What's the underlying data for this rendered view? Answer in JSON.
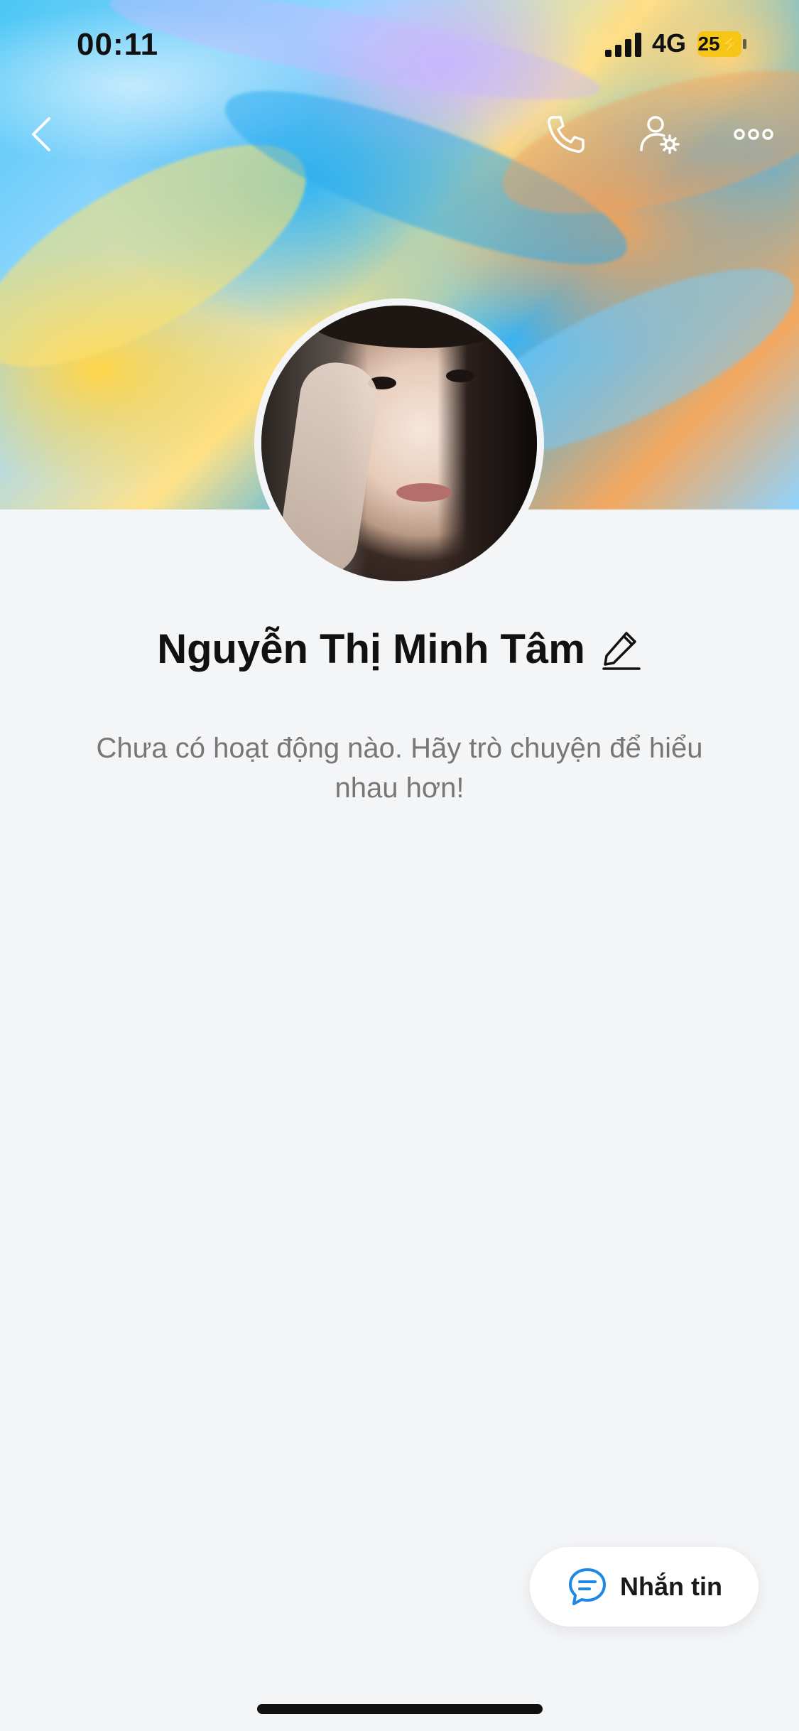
{
  "status_bar": {
    "time": "00:11",
    "network": "4G",
    "battery": "25"
  },
  "header": {
    "back_icon": "chevron-left-icon",
    "call_icon": "phone-icon",
    "settings_icon": "user-settings-icon",
    "more_icon": "more-horizontal-icon"
  },
  "profile": {
    "name": "Nguyễn Thị Minh Tâm",
    "edit_icon": "pencil-icon",
    "empty_message": "Chưa có hoạt động nào. Hãy trò chuyện để hiểu nhau hơn!"
  },
  "action": {
    "message_label": "Nhắn tin",
    "message_icon": "chat-bubble-icon",
    "accent": "#1e88e5"
  }
}
